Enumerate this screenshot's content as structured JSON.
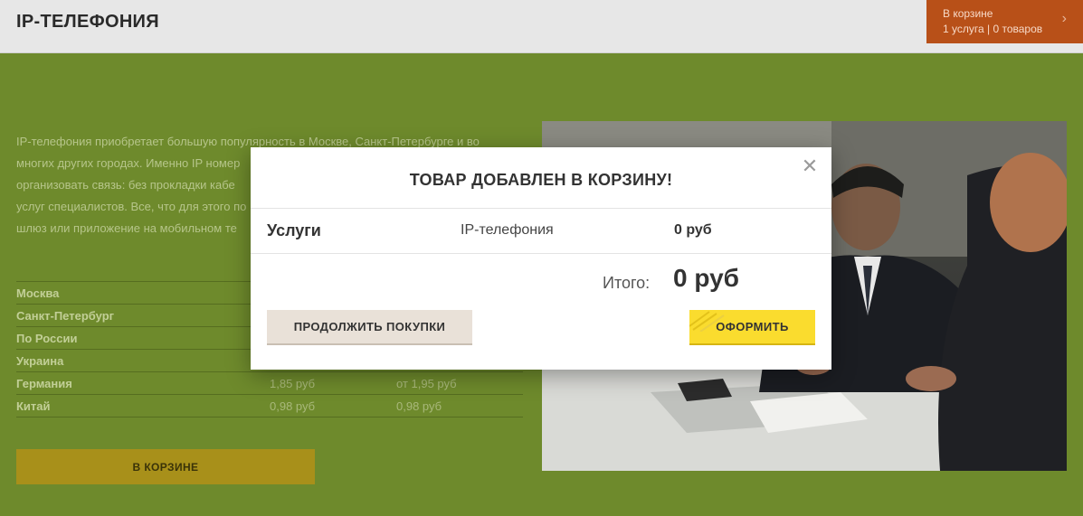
{
  "header": {
    "title": "IP-ТЕЛЕФОНИЯ",
    "cart": {
      "line1": "В корзине",
      "line2": "1 услуга | 0 товаров"
    }
  },
  "description": {
    "lines": [
      "IP-телефония приобретает большую популярность в Москве, Санкт-Петербурге и во",
      "многих других городах. Именно IP номер",
      "организовать связь: без прокладки кабе",
      "услуг специалистов. Все, что для этого по",
      "шлюз или приложение на мобильном те"
    ]
  },
  "prices": {
    "rows": [
      {
        "country": "Москва",
        "p1": "",
        "p2": ""
      },
      {
        "country": "Санкт-Петербург",
        "p1": "",
        "p2": ""
      },
      {
        "country": "По России",
        "p1": "",
        "p2": ""
      },
      {
        "country": "Украина",
        "p1": "",
        "p2": ""
      },
      {
        "country": "Германия",
        "p1": "1,85 руб",
        "p2": "от 1,95 руб"
      },
      {
        "country": "Китай",
        "p1": "0,98 руб",
        "p2": "0,98 руб"
      }
    ]
  },
  "page_button": {
    "label": "В КОРЗИНЕ"
  },
  "modal": {
    "close_icon": "close-icon",
    "title": "ТОВАР ДОБАВЛЕН В КОРЗИНУ!",
    "category": "Услуги",
    "item": "IP-телефония",
    "item_price": "0 руб",
    "total_label": "Итого:",
    "total_value": "0 руб",
    "continue_label": "ПРОДОЛЖИТЬ ПОКУПКИ",
    "checkout_label": "ОФОРМИТЬ"
  },
  "colors": {
    "accent_yellow": "#fadc2e",
    "cart_orange": "#b85018",
    "page_green": "#6e8a2c"
  }
}
